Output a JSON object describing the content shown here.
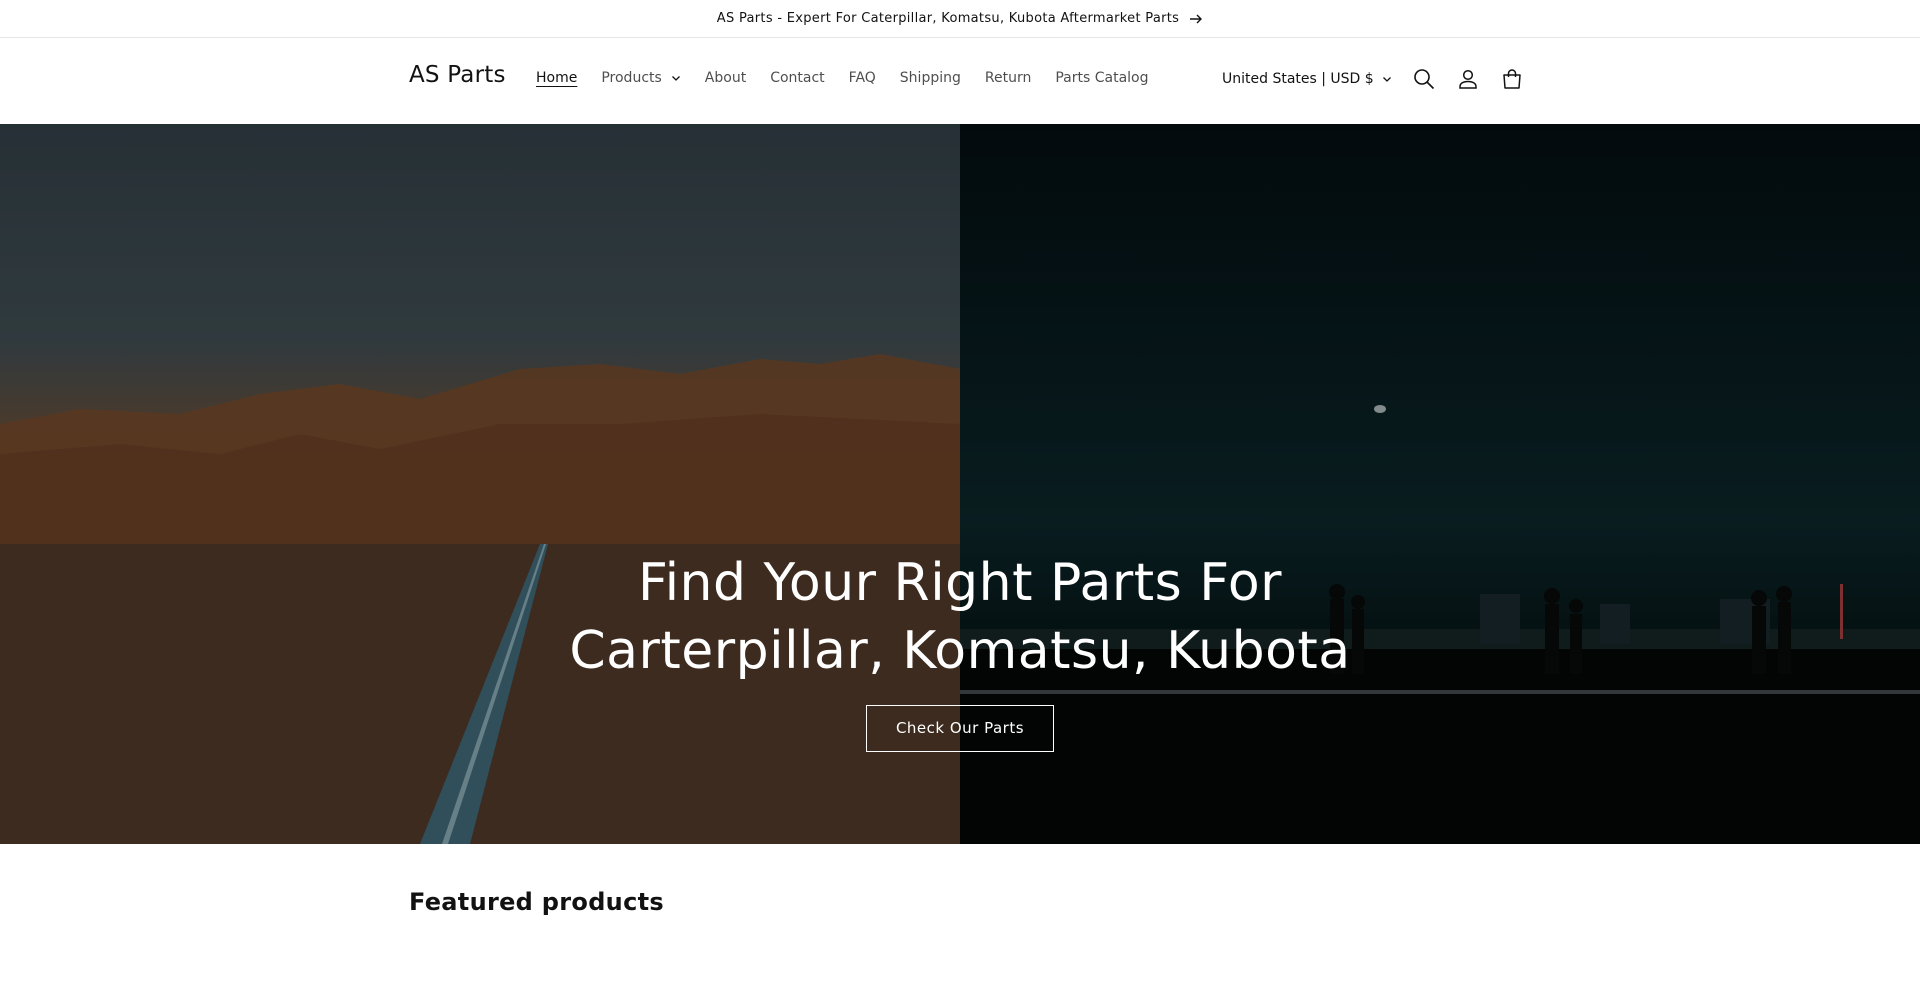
{
  "announcement": {
    "text": "AS Parts - Expert For Caterpillar, Komatsu, Kubota Aftermarket Parts"
  },
  "header": {
    "logo": "AS Parts",
    "nav": [
      "Home",
      "Products",
      "About",
      "Contact",
      "FAQ",
      "Shipping",
      "Return",
      "Parts Catalog"
    ],
    "country_selector": "United States | USD $",
    "icons": [
      "search-icon",
      "account-icon",
      "cart-icon"
    ]
  },
  "hero": {
    "title": "Find Your Right Parts For Carterpillar, Komatsu, Kubota",
    "button_label": "Check Our Parts"
  },
  "featured": {
    "heading": "Featured products"
  }
}
